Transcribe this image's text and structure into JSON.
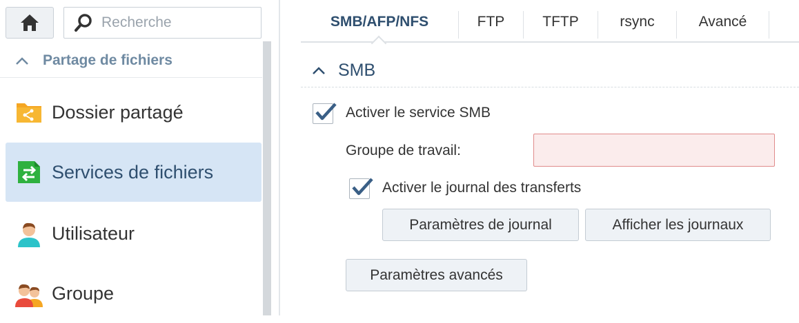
{
  "sidebar": {
    "home_icon": "home-icon",
    "search": {
      "placeholder": "Recherche",
      "value": ""
    },
    "section": {
      "label": "Partage de fichiers",
      "expanded": true
    },
    "items": [
      {
        "label": "Dossier partagé",
        "icon": "shared-folder-icon",
        "active": false
      },
      {
        "label": "Services de fichiers",
        "icon": "file-services-icon",
        "active": true
      },
      {
        "label": "Utilisateur",
        "icon": "user-icon",
        "active": false
      },
      {
        "label": "Groupe",
        "icon": "group-icon",
        "active": false
      }
    ]
  },
  "tabs": [
    {
      "label": "SMB/AFP/NFS",
      "active": true
    },
    {
      "label": "FTP",
      "active": false
    },
    {
      "label": "TFTP",
      "active": false
    },
    {
      "label": "rsync",
      "active": false
    },
    {
      "label": "Avancé",
      "active": false
    }
  ],
  "smb": {
    "section_title": "SMB",
    "enable_service": {
      "label": "Activer le service SMB",
      "checked": true
    },
    "workgroup": {
      "label": "Groupe de travail:",
      "value": ""
    },
    "enable_transfer_log": {
      "label": "Activer le journal des transferts",
      "checked": true
    },
    "log_settings_button": "Paramètres de journal",
    "view_logs_button": "Afficher les journaux",
    "advanced_settings_button": "Paramètres avancés"
  },
  "colors": {
    "accent": "#2f4f6f",
    "active_bg": "#d6e5f5",
    "error_bg": "#fbecec",
    "error_border": "#e08a8a",
    "check": "#3a5f86"
  }
}
